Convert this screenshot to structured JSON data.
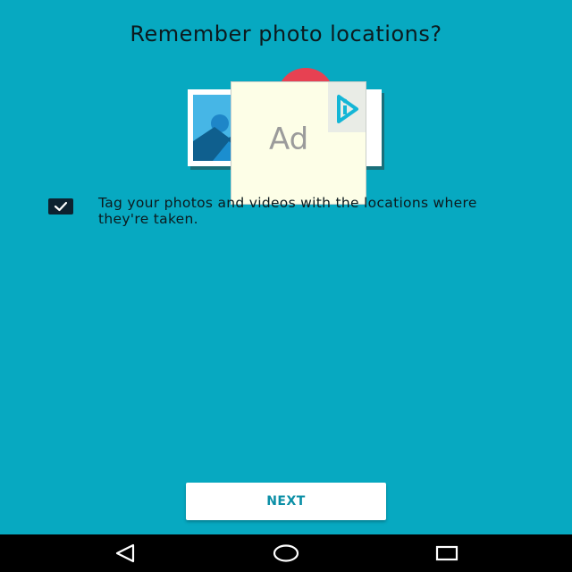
{
  "header": {
    "title": "Remember photo locations?"
  },
  "illustration": {
    "ad_label": "Ad"
  },
  "option": {
    "checked": true,
    "label": "Tag your photos and videos with the locations where they're taken."
  },
  "actions": {
    "next_label": "NEXT"
  },
  "colors": {
    "background": "#07a9c1",
    "button_text": "#0b8fa6",
    "pin": "#e74152",
    "navbar": "#000000"
  },
  "navbar": {
    "icons": [
      "back-icon",
      "home-icon",
      "recents-icon"
    ]
  }
}
